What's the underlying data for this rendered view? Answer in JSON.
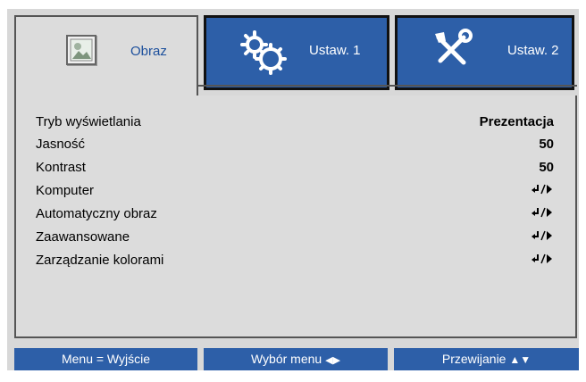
{
  "tabs": [
    {
      "label": "Obraz",
      "icon": "picture-icon",
      "active": true
    },
    {
      "label": "Ustaw. 1",
      "icon": "gears-icon",
      "active": false
    },
    {
      "label": "Ustaw. 2",
      "icon": "tools-icon",
      "active": false
    }
  ],
  "menu_items": [
    {
      "label": "Tryb wyświetlania",
      "value": "Prezentacja"
    },
    {
      "label": "Jasność",
      "value": "50"
    },
    {
      "label": "Kontrast",
      "value": "50"
    },
    {
      "label": "Komputer",
      "value": "enter-submenu-icon"
    },
    {
      "label": "Automatyczny obraz",
      "value": "enter-submenu-icon"
    },
    {
      "label": "Zaawansowane",
      "value": "enter-submenu-icon"
    },
    {
      "label": "Zarządzanie kolorami",
      "value": "enter-submenu-icon"
    }
  ],
  "footer": {
    "menu_exit": "Menu = Wyjście",
    "menu_select": "Wybór menu",
    "scroll": "Przewijanie"
  },
  "colors": {
    "accent_blue": "#2d5fa8",
    "panel_gray": "#dcdcdc",
    "active_tab_text": "#1c4f9c"
  }
}
